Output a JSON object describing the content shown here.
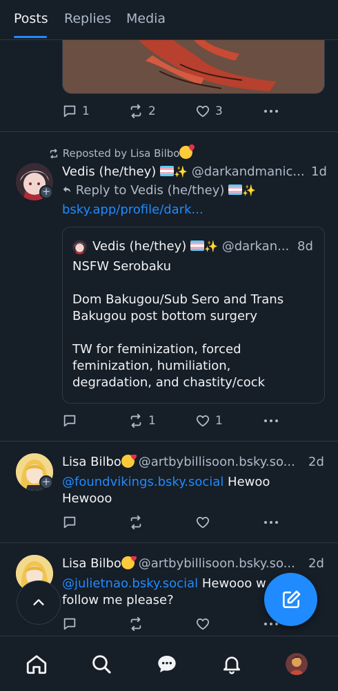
{
  "tabs": [
    {
      "label": "Posts",
      "active": true
    },
    {
      "label": "Replies",
      "active": false
    },
    {
      "label": "Media",
      "active": false
    }
  ],
  "post1": {
    "replies": "1",
    "reposts": "2",
    "likes": "3"
  },
  "post2": {
    "repost_label": "Reposted by Lisa Bilbo",
    "author": "Vedis (he/they)",
    "handle": "@darkandmanic...",
    "time": "1d",
    "reply_to": "Reply to Vedis (he/they)",
    "link": "bsky.app/profile/dark...",
    "quote": {
      "author": "Vedis (he/they)",
      "handle": "@darkan...",
      "time": "8d",
      "line1": "NSFW Serobaku",
      "para2": "Dom Bakugou/Sub Sero and Trans Bakugou post bottom surgery",
      "para3": "TW for feminization, forced feminization, humiliation, degradation, and chastity/cock"
    },
    "replies": "",
    "reposts": "1",
    "likes": "1"
  },
  "post3": {
    "author": "Lisa Bilbo",
    "handle": "@artbybillisoon.bsky.so...",
    "time": "2d",
    "mention": "@foundvikings.bsky.social",
    "text_after_mention": " Hewoo",
    "text_line2": "Hewooo"
  },
  "post4": {
    "author": "Lisa Bilbo",
    "handle": "@artbybillisoon.bsky.so...",
    "time": "2d",
    "mention": "@julietnao.bsky.social",
    "text_after_mention": " Hewooo w",
    "text_line2": "follow me please?"
  },
  "icons": {
    "reply": "speech-bubble-icon",
    "repost": "repost-arrows-icon",
    "like": "heart-icon",
    "more": "ellipsis-icon",
    "home": "home-icon",
    "search": "search-icon",
    "chat": "chat-icon",
    "notifications": "bell-icon",
    "compose": "compose-icon",
    "scroll_top": "chevron-up-icon"
  },
  "colors": {
    "background": "#161e27",
    "accent": "#208bfe",
    "muted": "#aebbc9",
    "border": "#2e3a48"
  }
}
